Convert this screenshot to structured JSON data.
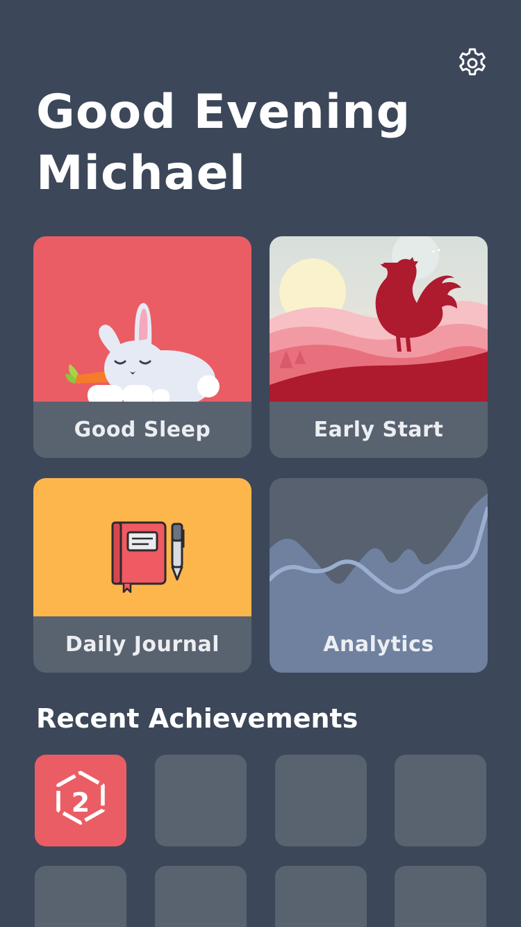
{
  "header": {
    "greeting_line1": "Good Evening",
    "greeting_line2": "Michael",
    "settings_icon": "gear-icon"
  },
  "cards": [
    {
      "label": "Good Sleep",
      "icon": "bunny-illustration",
      "color": "#ea5d64"
    },
    {
      "label": "Early Start",
      "icon": "rooster-sunrise-illustration",
      "color": "#b0192d"
    },
    {
      "label": "Daily Journal",
      "icon": "notebook-pen-illustration",
      "color": "#fdb64c"
    },
    {
      "label": "Analytics",
      "icon": "wave-chart-illustration",
      "color": "#6f819f"
    }
  ],
  "achievements": {
    "title": "Recent Achievements",
    "tiles": [
      {
        "badge": "2",
        "icon": "hexagon-badge-icon",
        "unlocked": true
      },
      {
        "unlocked": false
      },
      {
        "unlocked": false
      },
      {
        "unlocked": false
      },
      {
        "unlocked": false
      },
      {
        "unlocked": false
      },
      {
        "unlocked": false
      },
      {
        "unlocked": false
      }
    ]
  },
  "colors": {
    "background": "#3c4759",
    "tile": "#59626f",
    "accent": "#ea5d64"
  }
}
